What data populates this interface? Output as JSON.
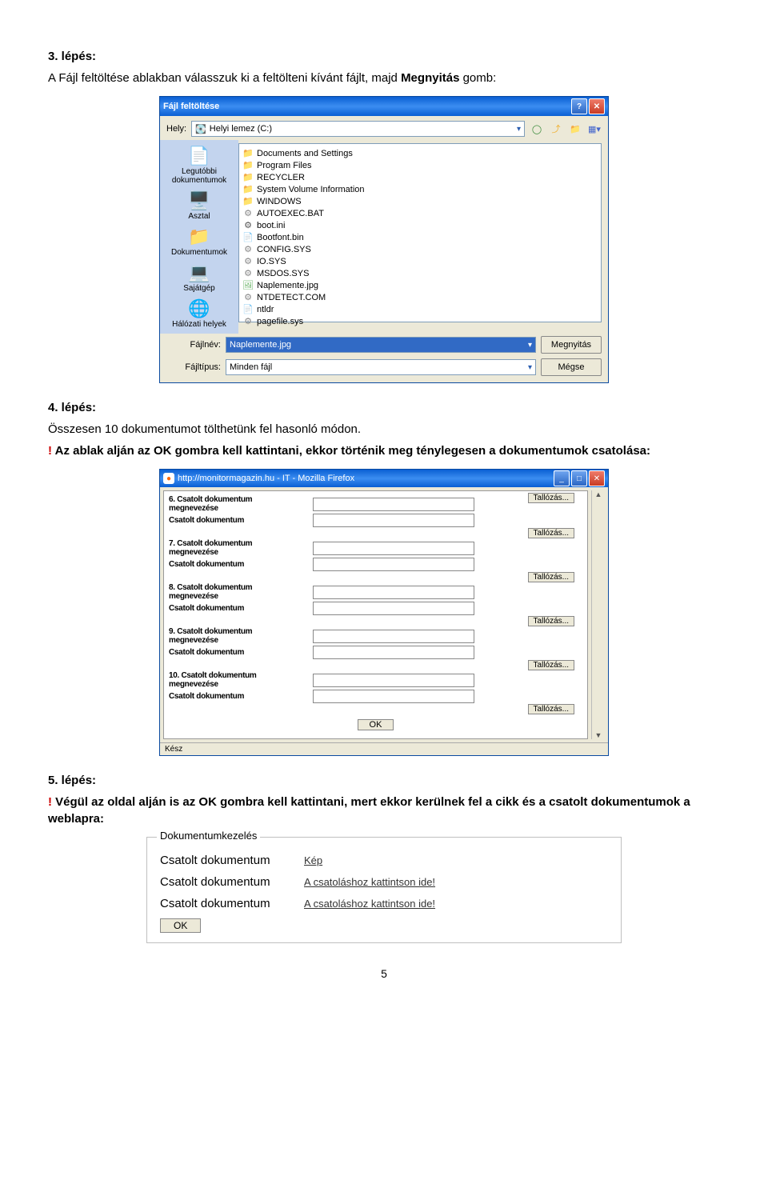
{
  "step3": {
    "heading": "3. lépés:",
    "p1a": "A Fájl feltöltése ablakban válasszuk ki a feltölteni kívánt fájlt, majd ",
    "p1b": "Megnyitás",
    "p1c": " gomb:"
  },
  "xp": {
    "title": "Fájl feltöltése",
    "helyLabel": "Hely:",
    "helyValue": "Helyi lemez (C:)",
    "side": [
      {
        "icon": "📄",
        "label": "Legutóbbi dokumentumok"
      },
      {
        "icon": "🖥️",
        "label": "Asztal"
      },
      {
        "icon": "📁",
        "label": "Dokumentumok"
      },
      {
        "icon": "💻",
        "label": "Sajátgép"
      },
      {
        "icon": "🌐",
        "label": "Hálózati helyek"
      }
    ],
    "files": [
      {
        "icon": "📁",
        "name": "Documents and Settings",
        "cls": "foldc"
      },
      {
        "icon": "📁",
        "name": "Program Files",
        "cls": "foldc"
      },
      {
        "icon": "📁",
        "name": "RECYCLER",
        "cls": "foldc"
      },
      {
        "icon": "📁",
        "name": "System Volume Information",
        "cls": "foldc"
      },
      {
        "icon": "📁",
        "name": "WINDOWS",
        "cls": "foldc"
      },
      {
        "icon": "⚙",
        "name": "AUTOEXEC.BAT",
        "cls": "cogc"
      },
      {
        "icon": "⚙",
        "name": "boot.ini",
        "cls": "inic"
      },
      {
        "icon": "📄",
        "name": "Bootfont.bin",
        "cls": "inic"
      },
      {
        "icon": "⚙",
        "name": "CONFIG.SYS",
        "cls": "cogc"
      },
      {
        "icon": "⚙",
        "name": "IO.SYS",
        "cls": "cogc"
      },
      {
        "icon": "⚙",
        "name": "MSDOS.SYS",
        "cls": "cogc"
      },
      {
        "icon": "🖼",
        "name": "Naplemente.jpg",
        "cls": "imgc"
      },
      {
        "icon": "⚙",
        "name": "NTDETECT.COM",
        "cls": "cogc"
      },
      {
        "icon": "📄",
        "name": "ntldr",
        "cls": "inic"
      },
      {
        "icon": "⚙",
        "name": "pagefile.sys",
        "cls": "cogc"
      }
    ],
    "fileNameLabel": "Fájlnév:",
    "fileNameValue": "Naplemente.jpg",
    "fileTypeLabel": "Fájltípus:",
    "fileTypeValue": "Minden fájl",
    "openBtn": "Megnyitás",
    "cancelBtn": "Mégse"
  },
  "step4": {
    "heading": "4. lépés:",
    "p1": "Összesen 10 dokumentumot tölthetünk fel hasonló módon.",
    "p2a": "! ",
    "p2b": "Az ablak alján az OK gombra kell kattintani, ekkor történik meg ténylegesen a dokumentumok csatolása:"
  },
  "ff": {
    "title": "http://monitormagazin.hu - IT - Mozilla Firefox",
    "rows": [
      {
        "l1": "6. Csatolt dokumentum",
        "l2": "megnevezése"
      },
      {
        "l1": "Csatolt dokumentum"
      },
      {
        "l1": "7. Csatolt dokumentum",
        "l2": "megnevezése"
      },
      {
        "l1": "Csatolt dokumentum"
      },
      {
        "l1": "8. Csatolt dokumentum",
        "l2": "megnevezése"
      },
      {
        "l1": "Csatolt dokumentum"
      },
      {
        "l1": "9. Csatolt dokumentum",
        "l2": "megnevezése"
      },
      {
        "l1": "Csatolt dokumentum"
      },
      {
        "l1": "10. Csatolt dokumentum",
        "l2": "megnevezése"
      },
      {
        "l1": "Csatolt dokumentum"
      }
    ],
    "browseBtn": "Tallózás...",
    "okBtn": "OK",
    "status": "Kész"
  },
  "step5": {
    "heading": "5. lépés:",
    "p1a": "! ",
    "p1b": "Végül az oldal alján is az OK gombra kell kattintani, mert ekkor kerülnek fel a cikk és a csatolt dokumentumok a weblapra:"
  },
  "web": {
    "legend": "Dokumentumkezelés",
    "rows": [
      {
        "label": "Csatolt dokumentum",
        "value": "Kép"
      },
      {
        "label": "Csatolt dokumentum",
        "value": "A csatoláshoz kattintson ide!"
      },
      {
        "label": "Csatolt dokumentum",
        "value": "A csatoláshoz kattintson ide!"
      }
    ],
    "okBtn": "OK"
  },
  "pagenum": "5"
}
